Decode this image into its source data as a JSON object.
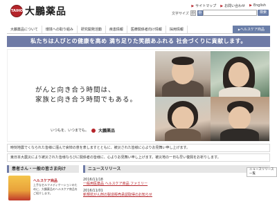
{
  "header": {
    "logo_mark": "TAIHO",
    "logo_text": "大鵬薬品",
    "util_links": [
      "サイトマップ",
      "お問い合わせ",
      "English"
    ],
    "fontsize_label": "文字サイズ",
    "fontsize_options": [
      "小",
      "中",
      "大"
    ],
    "search_placeholder": "",
    "search_button": "検索"
  },
  "nav": {
    "items": [
      "大鵬薬品について",
      "環境への取り組み",
      "研究開発活動",
      "疾患情報",
      "医療関係者向け情報",
      "採用情報"
    ],
    "healthcare": "ヘルスケア商品"
  },
  "slogan": "私たちは人びとの健康を高め 満ち足りた笑顔あふれる 社会づくりに貢献します。",
  "hero": {
    "copy_line1": "がんと向き合う時間は、",
    "copy_line2": "家族と向き合う時間でもある。",
    "tagline": "いつもを、いつまでも。",
    "brand": "大鵬薬品"
  },
  "notices": [
    "時刻地震でくなられた皆様に謹んで哀悼の意を表しますとともに、被災された皆様に心よりお見舞い申し上げます。",
    "東日本大震災により被災された皆様ならびに関係者の皆様に、心よりお見舞い申し上げます。被災地の一日も早い復興をお祈りします。"
  ],
  "sections": {
    "consumer_title": "患者さん・一般の皆さま向け",
    "news_title": "ニュースリリース",
    "news_more": "ニュースリリース一覧"
  },
  "consumer": {
    "product_title": "ヘルスケア商品",
    "product_desc": "上手なセルフメディケーションのために、大鵬薬品のヘルスケア商品をご紹介します。"
  },
  "news": [
    {
      "date": "2016/11/18",
      "text": "一般用医薬品 ヘルスケア商品 ファミリー"
    },
    {
      "date": "2016/11/01",
      "text": "新規抗がん剤の製造販売承認取得のお知らせ"
    }
  ],
  "colors": {
    "accent": "#6f7ba6",
    "brand_red": "#b5242a"
  }
}
